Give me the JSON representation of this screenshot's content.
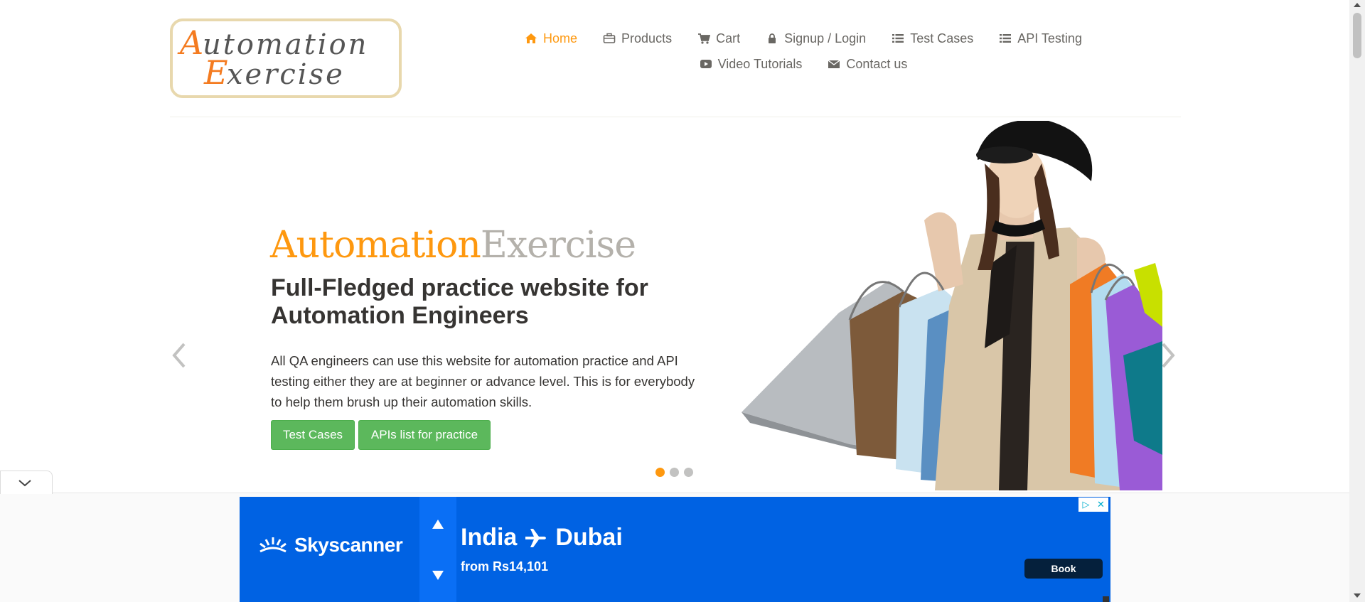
{
  "header": {
    "logo_text_line1": "Automation",
    "logo_text_line2": "Exercise",
    "nav": [
      {
        "label": "Home",
        "icon": "home-icon",
        "active": true
      },
      {
        "label": "Products",
        "icon": "briefcase-icon"
      },
      {
        "label": "Cart",
        "icon": "cart-icon"
      },
      {
        "label": "Signup / Login",
        "icon": "lock-icon"
      },
      {
        "label": "Test Cases",
        "icon": "list-icon"
      },
      {
        "label": "API Testing",
        "icon": "list-icon"
      },
      {
        "label": "Video Tutorials",
        "icon": "youtube-play-icon"
      },
      {
        "label": "Contact us",
        "icon": "envelope-icon"
      }
    ],
    "colors": {
      "active": "#fe980f",
      "inactive": "#696763"
    }
  },
  "slider": {
    "brand_part1": "Automation",
    "brand_part2": "Exercise",
    "headline": "Full-Fledged practice website for Automation Engineers",
    "description": "All QA engineers can use this website for automation practice and API testing either they are at beginner or advance level. This is for everybody to help them brush up their automation skills.",
    "button_test_cases": "Test Cases",
    "button_apis": "APIs list for practice",
    "dot_count": 3,
    "active_dot": 0
  },
  "ad": {
    "brand": "Skyscanner",
    "route_from": "India",
    "route_to": "Dubai",
    "price_text": "from Rs14,101",
    "book_label": "Book",
    "colors": {
      "background": "#0062e3",
      "book": "#05203c"
    }
  }
}
